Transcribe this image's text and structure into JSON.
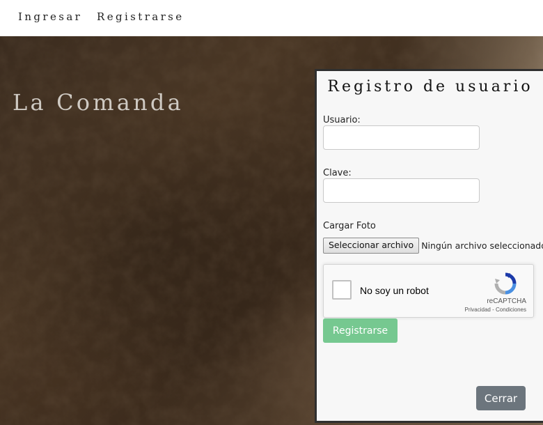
{
  "nav": {
    "login_label": "Ingresar",
    "register_label": "Registrarse"
  },
  "hero": {
    "brand_title": "La Comanda"
  },
  "register_panel": {
    "title": "Registro de usuario",
    "user_label": "Usuario:",
    "user_value": "",
    "password_label": "Clave:",
    "password_value": "",
    "photo_label": "Cargar Foto",
    "file_button_label": "Seleccionar archivo",
    "file_status": "Ningún archivo seleccionado",
    "captcha": {
      "label": "No soy un robot",
      "checked": false,
      "brand": "reCAPTCHA",
      "privacy_link": "Privacidad",
      "separator": " - ",
      "terms_link": "Condiciones"
    },
    "submit_label": "Registrarse",
    "close_label": "Cerrar"
  },
  "colors": {
    "submit_button": "#76c890",
    "close_button": "#6c757d",
    "panel_border": "#2f2f2f",
    "brand_title": "#cfcac3"
  },
  "icons": {
    "captcha_logo": "recaptcha-logo-icon"
  }
}
